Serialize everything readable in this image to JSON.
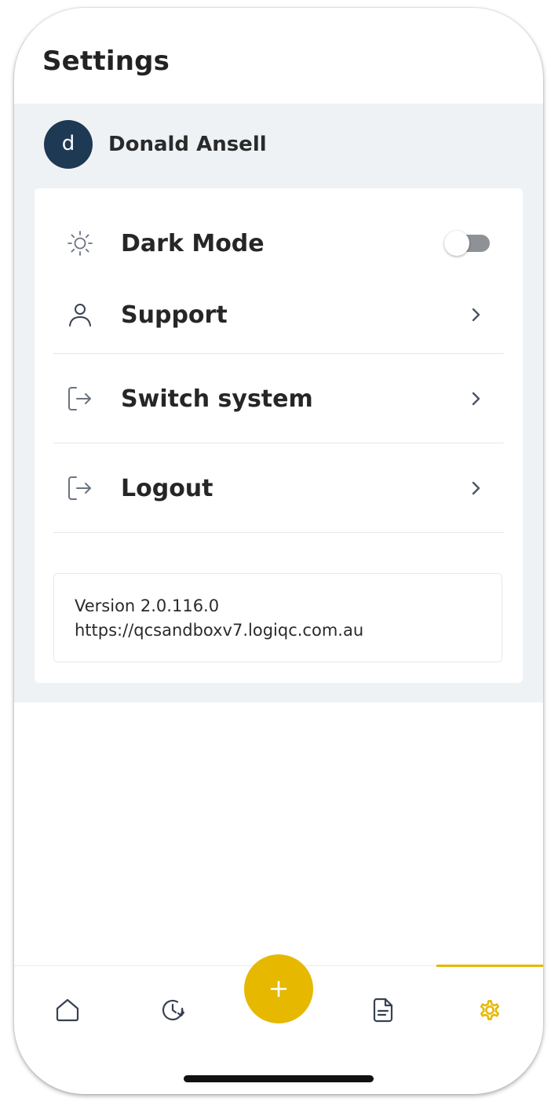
{
  "header": {
    "title": "Settings"
  },
  "profile": {
    "initial": "d",
    "name": "Donald Ansell"
  },
  "menu": {
    "dark_mode": {
      "label": "Dark Mode",
      "icon": "sun-icon",
      "enabled": false
    },
    "items": [
      {
        "label": "Support",
        "icon": "user-icon"
      },
      {
        "label": "Switch system",
        "icon": "switch-system-icon"
      },
      {
        "label": "Logout",
        "icon": "logout-icon"
      }
    ]
  },
  "version_info": {
    "version": "Version 2.0.116.0",
    "url": "https://qcsandboxv7.logiqc.com.au"
  },
  "bottom_nav": {
    "items": [
      {
        "icon": "home-icon",
        "active": false
      },
      {
        "icon": "history-icon",
        "active": false
      },
      {
        "icon": "document-icon",
        "active": false
      },
      {
        "icon": "settings-gear-icon",
        "active": true
      }
    ],
    "fab_icon": "plus-icon"
  },
  "colors": {
    "accent": "#e6b800",
    "avatar_bg": "#1e3954",
    "band_bg": "#eff2f5",
    "icon_gray": "#6b7280"
  }
}
